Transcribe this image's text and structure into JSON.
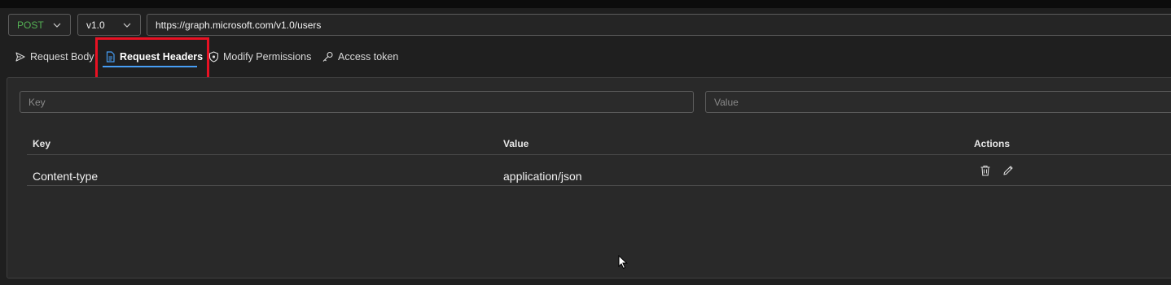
{
  "query": {
    "method": "POST",
    "version": "v1.0",
    "url": "https://graph.microsoft.com/v1.0/users"
  },
  "tabs": [
    {
      "label": "Request Body",
      "icon": "send-icon"
    },
    {
      "label": "Request Headers",
      "icon": "document-icon",
      "active": true
    },
    {
      "label": "Modify Permissions",
      "icon": "shield-icon"
    },
    {
      "label": "Access token",
      "icon": "key-icon"
    }
  ],
  "headers_form": {
    "key_placeholder": "Key",
    "value_placeholder": "Value"
  },
  "table": {
    "columns": [
      "Key",
      "Value",
      "Actions"
    ],
    "rows": [
      {
        "key": "Content-type",
        "value": "application/json",
        "actions": [
          "delete-icon",
          "edit-icon"
        ]
      }
    ]
  },
  "colors": {
    "method": "#54b054",
    "active_underline": "#479ef5",
    "highlight": "#e81123"
  }
}
